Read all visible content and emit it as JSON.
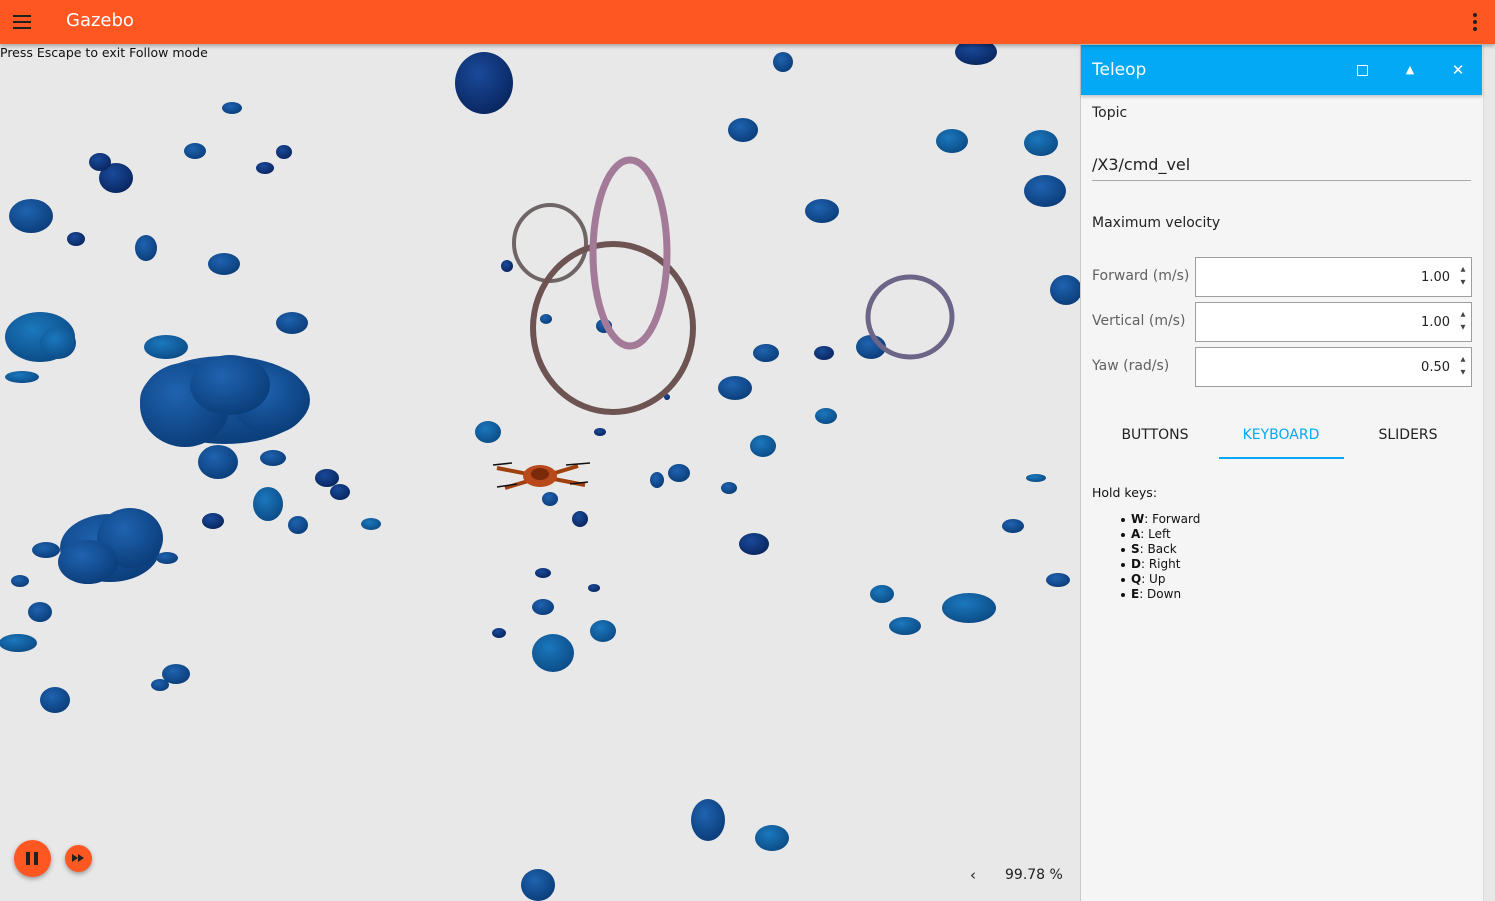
{
  "app": {
    "title": "Gazebo"
  },
  "scene": {
    "hint": "Press Escape to exit Follow mode",
    "real_time_factor": "99.78 %"
  },
  "teleop": {
    "title": "Teleop",
    "topic_label": "Topic",
    "topic_value": "/X3/cmd_vel",
    "max_velocity_label": "Maximum velocity",
    "velocities": [
      {
        "label": "Forward (m/s)",
        "value": "1.00"
      },
      {
        "label": "Vertical (m/s)",
        "value": "1.00"
      },
      {
        "label": "Yaw (rad/s)",
        "value": "0.50"
      }
    ],
    "tabs": [
      {
        "label": "BUTTONS",
        "active": false
      },
      {
        "label": "KEYBOARD",
        "active": true
      },
      {
        "label": "SLIDERS",
        "active": false
      }
    ],
    "hold_keys_label": "Hold keys:",
    "keys": [
      {
        "key": "W",
        "action": ": Forward"
      },
      {
        "key": "A",
        "action": ": Left"
      },
      {
        "key": "S",
        "action": ": Back"
      },
      {
        "key": "D",
        "action": ": Right"
      },
      {
        "key": "Q",
        "action": ": Up"
      },
      {
        "key": "E",
        "action": ": Down"
      }
    ]
  },
  "colors": {
    "toolbar": "#ff5722",
    "panel_header": "#03a9f4",
    "scene_background": "#e8e8e8",
    "obstacle_dark": "#0d2f6e",
    "obstacle_mid": "#0d4f8c",
    "obstacle_light": "#1565a8"
  },
  "icons": {
    "menu": "hamburger-menu-icon",
    "more": "more-vert-icon",
    "maximize": "maximize-icon",
    "collapse": "collapse-arrow-icon",
    "close": "close-icon",
    "pause": "pause-icon",
    "step": "fast-forward-icon",
    "rtf_toggle": "chevron-left-icon"
  }
}
